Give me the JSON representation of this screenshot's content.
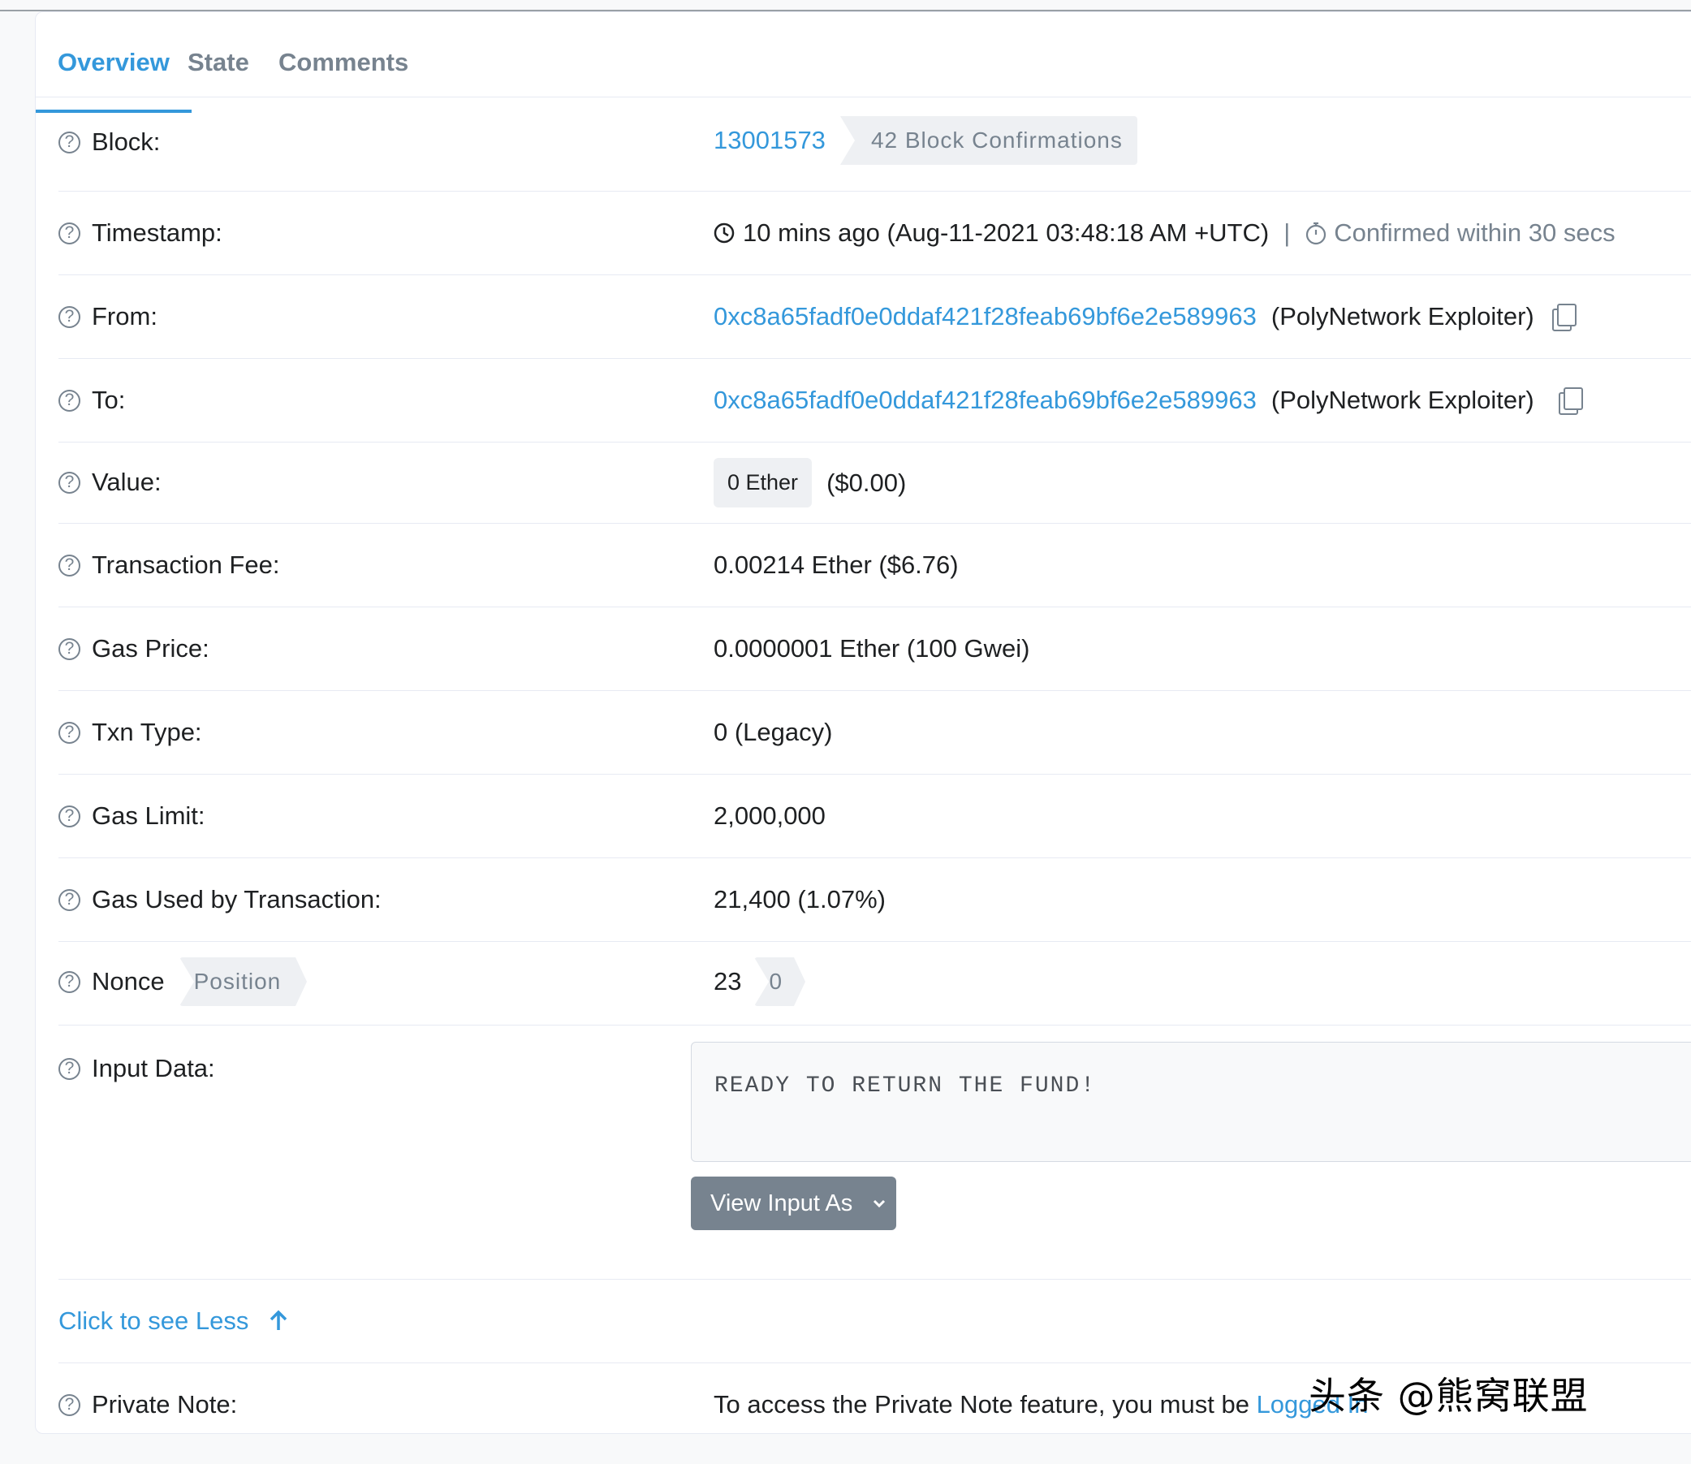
{
  "tabs": [
    "Overview",
    "State",
    "Comments"
  ],
  "block": {
    "label": "Block:",
    "number": "13001573",
    "confirmations": "42 Block Confirmations"
  },
  "timestamp": {
    "label": "Timestamp:",
    "value": "10 mins ago (Aug-11-2021 03:48:18 AM +UTC)",
    "separator": "|",
    "confirmed": "Confirmed within 30 secs"
  },
  "from": {
    "label": "From:",
    "address": "0xc8a65fadf0e0ddaf421f28feab69bf6e2e589963",
    "name": "(PolyNetwork Exploiter)"
  },
  "to": {
    "label": "To:",
    "address": "0xc8a65fadf0e0ddaf421f28feab69bf6e2e589963",
    "name": "(PolyNetwork Exploiter)"
  },
  "value": {
    "label": "Value:",
    "badge": "0 Ether",
    "usd": "($0.00)"
  },
  "fee": {
    "label": "Transaction Fee:",
    "value": "0.00214 Ether ($6.76)"
  },
  "gas_price": {
    "label": "Gas Price:",
    "value": "0.0000001 Ether (100 Gwei)"
  },
  "txn_type": {
    "label": "Txn Type:",
    "value": "0 (Legacy)"
  },
  "gas_limit": {
    "label": "Gas Limit:",
    "value": "2,000,000"
  },
  "gas_used": {
    "label": "Gas Used by Transaction:",
    "value": "21,400 (1.07%)"
  },
  "nonce": {
    "label": "Nonce",
    "position_label": "Position",
    "value": "23",
    "position": "0"
  },
  "input": {
    "label": "Input Data:",
    "text": "READY TO RETURN THE FUND!",
    "button": "View Input As"
  },
  "see_less": "Click to see Less",
  "private_note": {
    "label": "Private Note:",
    "text": "To access the Private Note feature, you must be ",
    "link": "Logged In"
  },
  "watermark": "头条 @熊窝联盟",
  "colors": {
    "accent": "#3498db",
    "muted": "#77838f",
    "text": "#1e2022",
    "button": "#77838f"
  }
}
